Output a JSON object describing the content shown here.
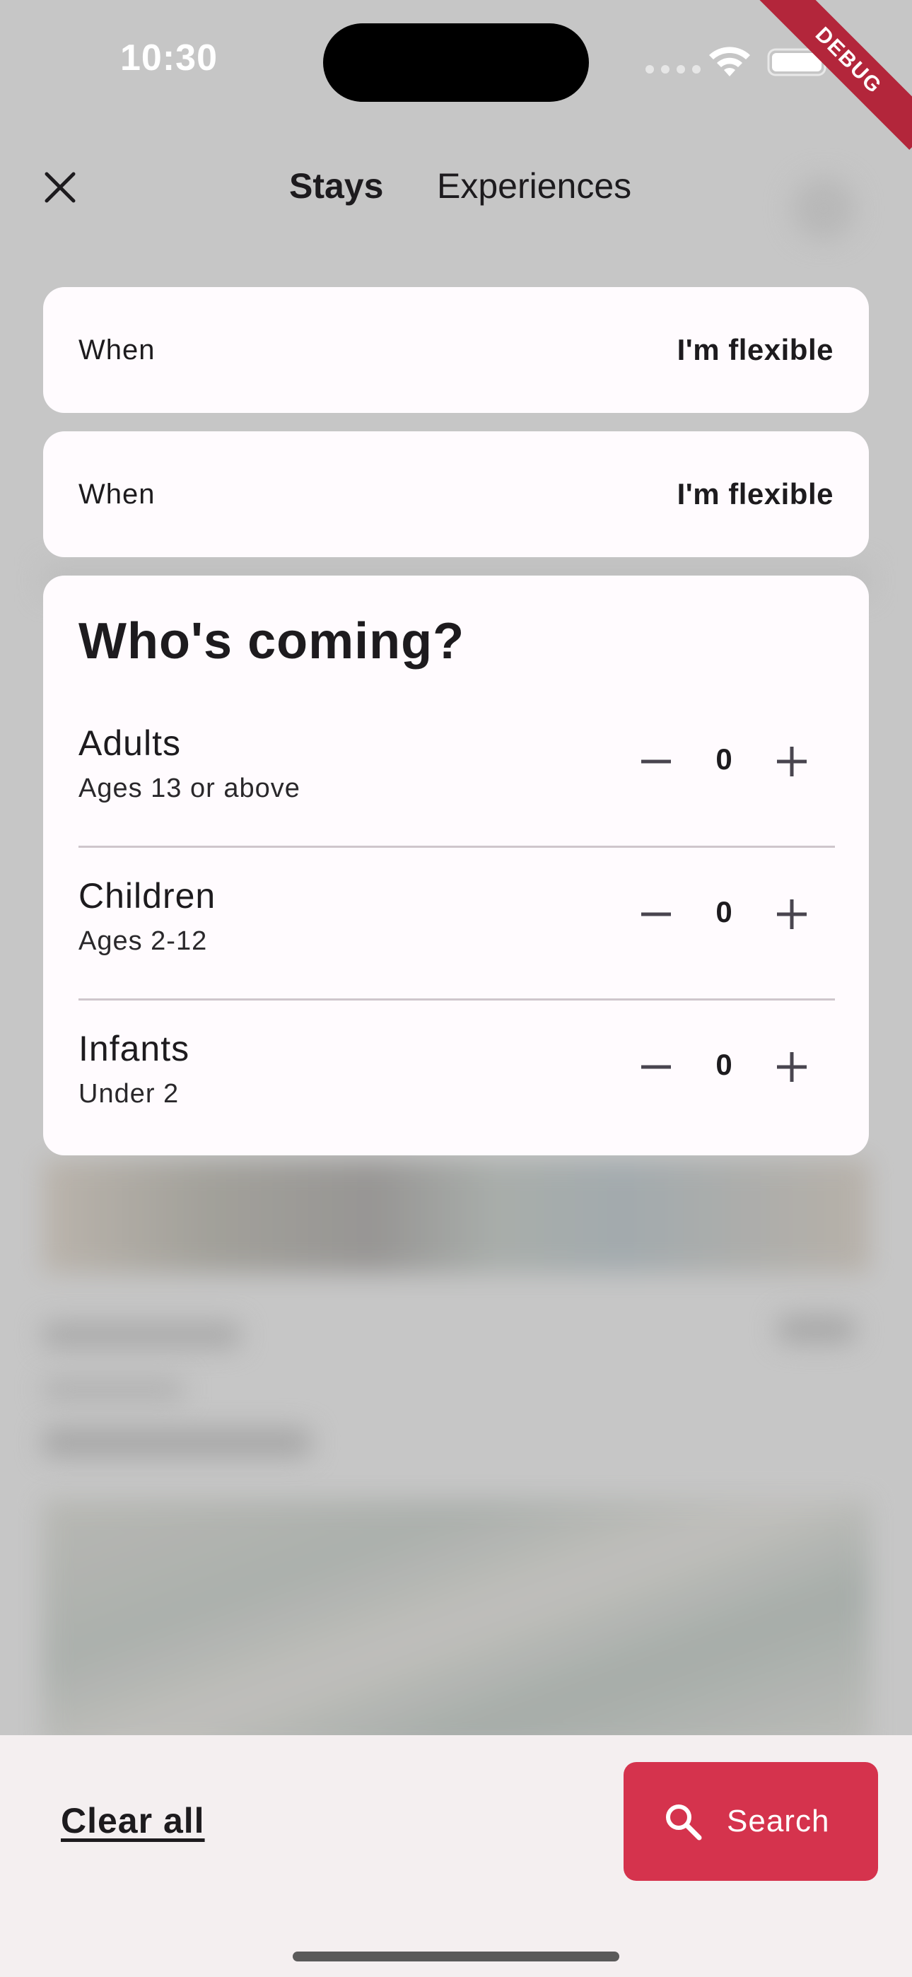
{
  "status_bar": {
    "time": "10:30",
    "debug_label": "DEBUG"
  },
  "nav": {
    "tabs": [
      {
        "label": "Stays",
        "selected": true
      },
      {
        "label": "Experiences",
        "selected": false
      }
    ],
    "close_icon": "close-icon"
  },
  "when_cards": [
    {
      "label": "When",
      "value": "I'm flexible"
    },
    {
      "label": "When",
      "value": "I'm flexible"
    }
  ],
  "guests": {
    "title": "Who's coming?",
    "rows": [
      {
        "name": "Adults",
        "description": "Ages 13 or above",
        "count": "0"
      },
      {
        "name": "Children",
        "description": "Ages 2-12",
        "count": "0"
      },
      {
        "name": "Infants",
        "description": "Under 2",
        "count": "0"
      }
    ]
  },
  "bottom_bar": {
    "clear_label": "Clear all",
    "search_label": "Search",
    "search_icon": "search-icon"
  },
  "colors": {
    "accent": "#d5334d",
    "card_bg": "#fffbfe",
    "scrim": "#c6c6c6",
    "bottom_bar_bg": "#f4eff0",
    "debug_banner": "#b3263b"
  }
}
